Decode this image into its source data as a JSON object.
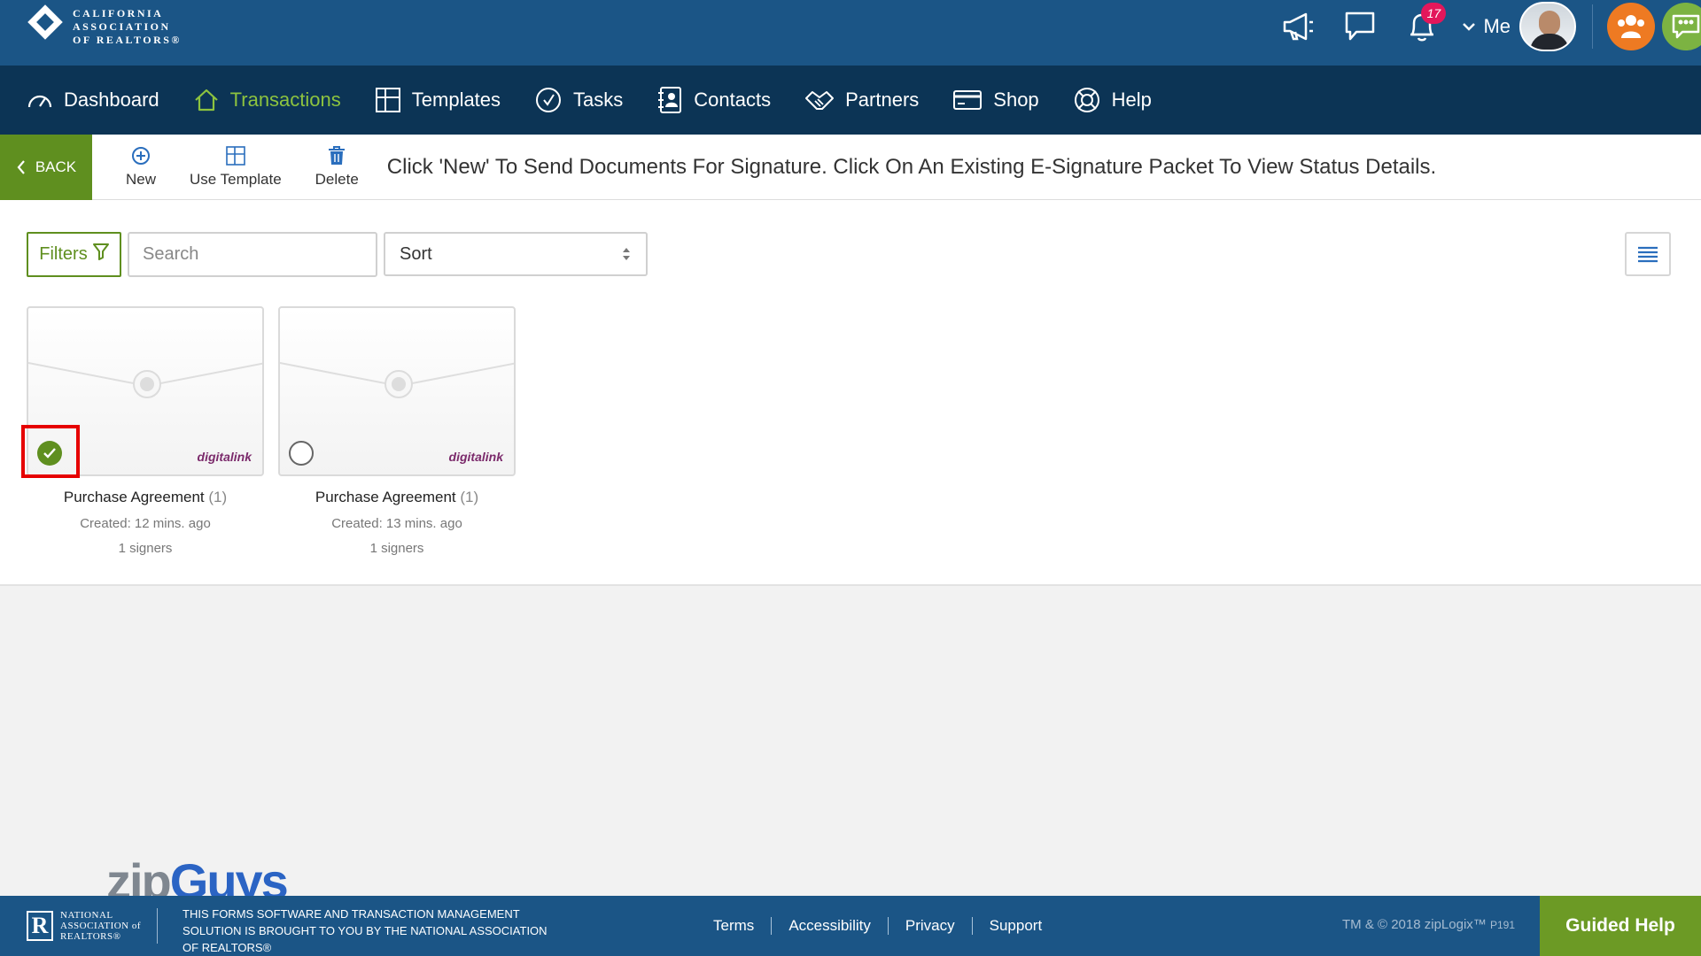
{
  "header": {
    "logo_lines": [
      "CALIFORNIA",
      "ASSOCIATION",
      "OF REALTORS®"
    ],
    "notifications_count": "17",
    "me_label": "Me"
  },
  "nav": {
    "items": [
      {
        "label": "Dashboard"
      },
      {
        "label": "Transactions"
      },
      {
        "label": "Templates"
      },
      {
        "label": "Tasks"
      },
      {
        "label": "Contacts"
      },
      {
        "label": "Partners"
      },
      {
        "label": "Shop"
      },
      {
        "label": "Help"
      }
    ],
    "active": "Transactions"
  },
  "toolbar": {
    "back_label": "BACK",
    "new_label": "New",
    "use_template_label": "Use Template",
    "delete_label": "Delete",
    "instructions": "Click 'New' To Send Documents For Signature. Click On An Existing E-Signature Packet To View Status Details."
  },
  "controls": {
    "filters_label": "Filters",
    "search_placeholder": "Search",
    "sort_label": "Sort"
  },
  "packets": [
    {
      "title": "Purchase Agreement",
      "count": "(1)",
      "created": "Created: 12 mins. ago",
      "signers": "1 signers",
      "selected": true
    },
    {
      "title": "Purchase Agreement",
      "count": "(1)",
      "created": "Created: 13 mins. ago",
      "signers": "1 signers",
      "selected": false
    }
  ],
  "card_brand": "digitalink",
  "brand_overlay": {
    "part1": "zip",
    "part2": "Guys"
  },
  "footer": {
    "nar_lines": [
      "NATIONAL",
      "ASSOCIATION of",
      "REALTORS®"
    ],
    "disclaimer": "THIS FORMS SOFTWARE AND TRANSACTION MANAGEMENT SOLUTION IS BROUGHT TO YOU BY THE NATIONAL ASSOCIATION OF REALTORS®",
    "links": [
      "Terms",
      "Accessibility",
      "Privacy",
      "Support"
    ],
    "copyright": "TM & © 2018 zipLogix™",
    "version": "P191",
    "guided_help": "Guided Help"
  },
  "colors": {
    "header_bg": "#1b5586",
    "nav_bg": "#0c3455",
    "accent_green": "#5f8f1f",
    "active_nav": "#8dc33f",
    "badge": "#e3175b",
    "highlight": "#e60000"
  }
}
